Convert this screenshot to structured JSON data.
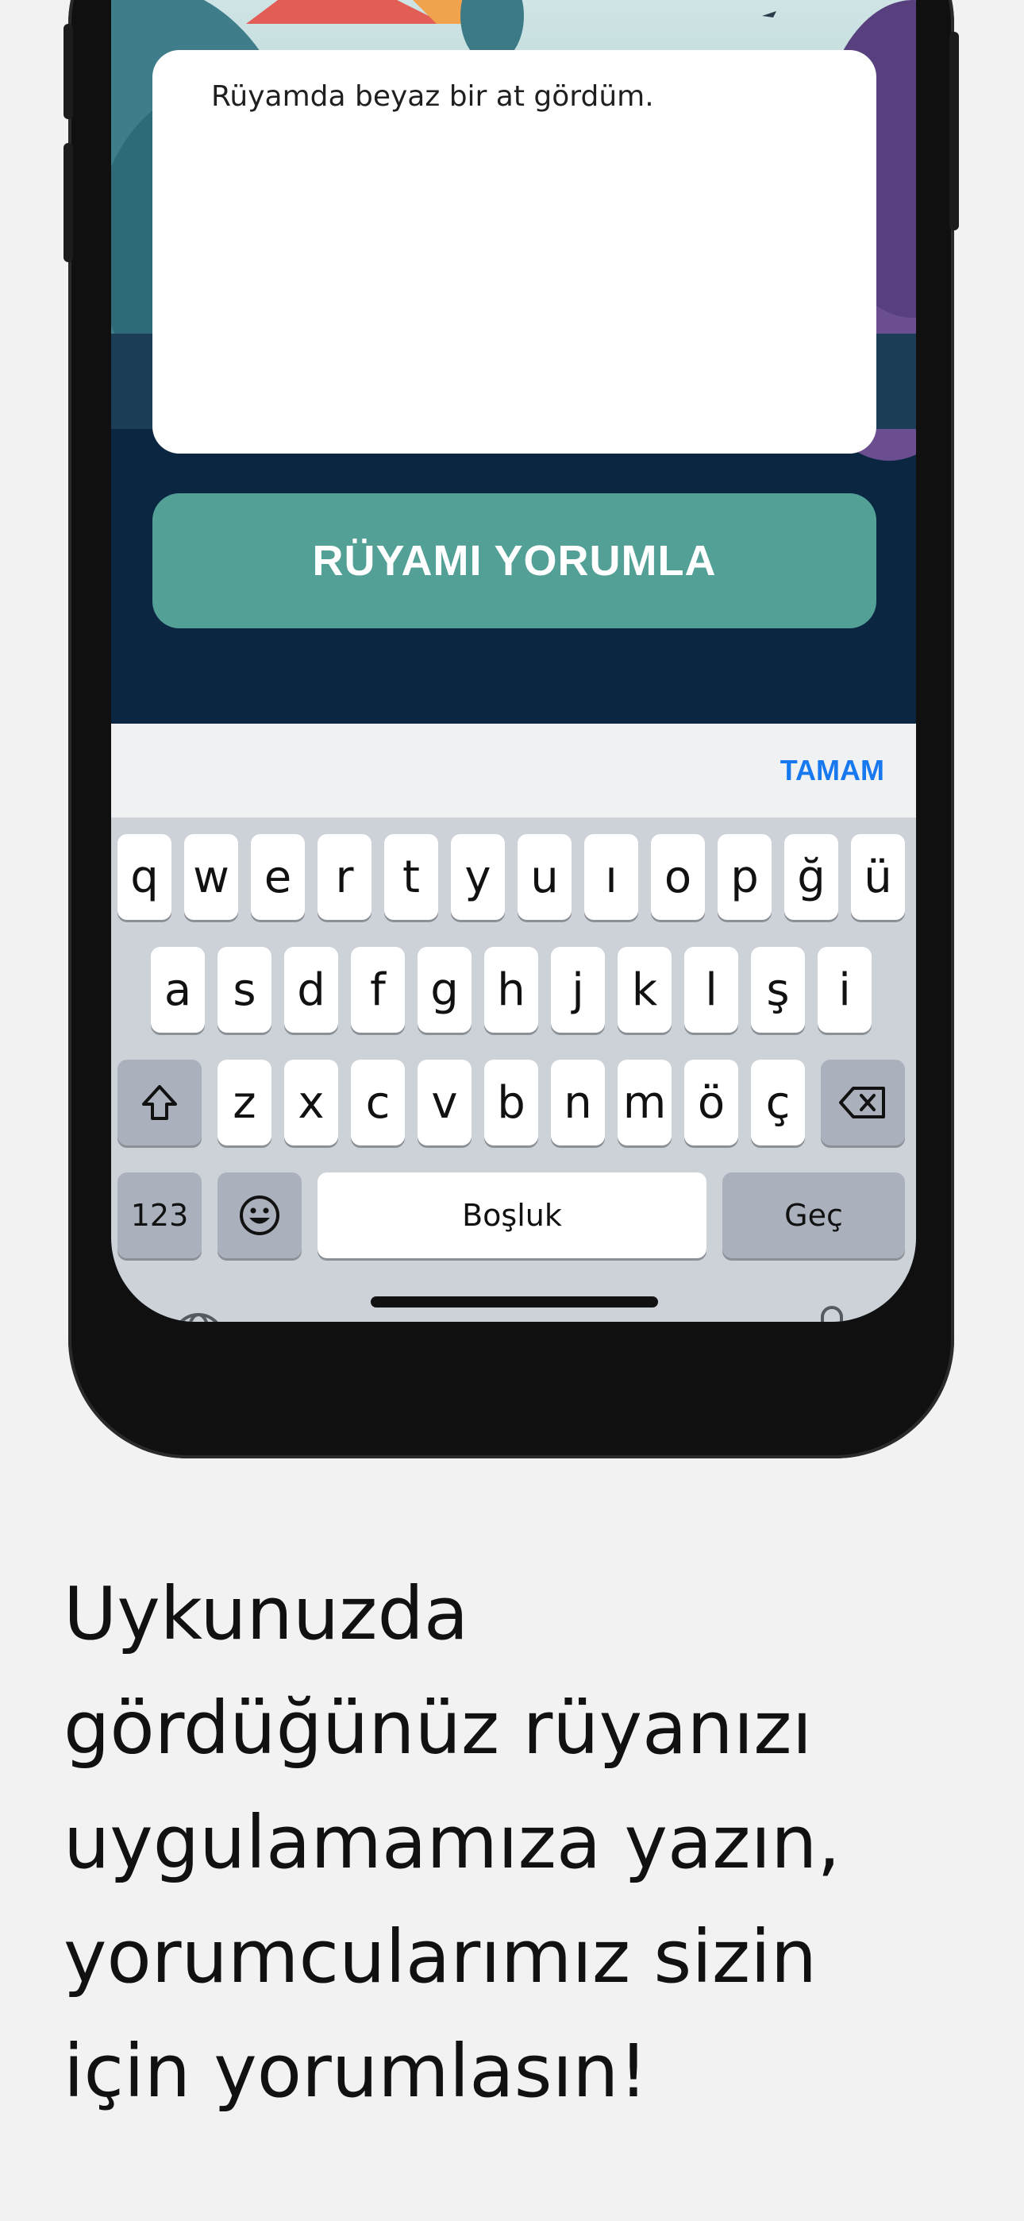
{
  "dream_input": {
    "value": "Rüyamda beyaz bir at gördüm."
  },
  "cta": {
    "label": "RÜYAMI YORUMLA"
  },
  "keyboard": {
    "toolbar_done": "TAMAM",
    "row1": [
      "q",
      "w",
      "e",
      "r",
      "t",
      "y",
      "u",
      "ı",
      "o",
      "p",
      "ğ",
      "ü"
    ],
    "row2": [
      "a",
      "s",
      "d",
      "f",
      "g",
      "h",
      "j",
      "k",
      "l",
      "ş",
      "i"
    ],
    "row3": [
      "z",
      "x",
      "c",
      "v",
      "b",
      "n",
      "m",
      "ö",
      "ç"
    ],
    "numbers_key": "123",
    "space_key": "Boşluk",
    "return_key": "Geç"
  },
  "caption": {
    "lines": [
      "Uykunuzda",
      "gördüğünüz rüyanızı",
      "uygulamamıza yazın,",
      "yorumcularımız sizin",
      "için yorumlasın!"
    ]
  },
  "colors": {
    "cta": "#53a096",
    "done": "#1878f0",
    "screen_bg": "#0a2640",
    "page_bg": "#f2f2f2"
  }
}
